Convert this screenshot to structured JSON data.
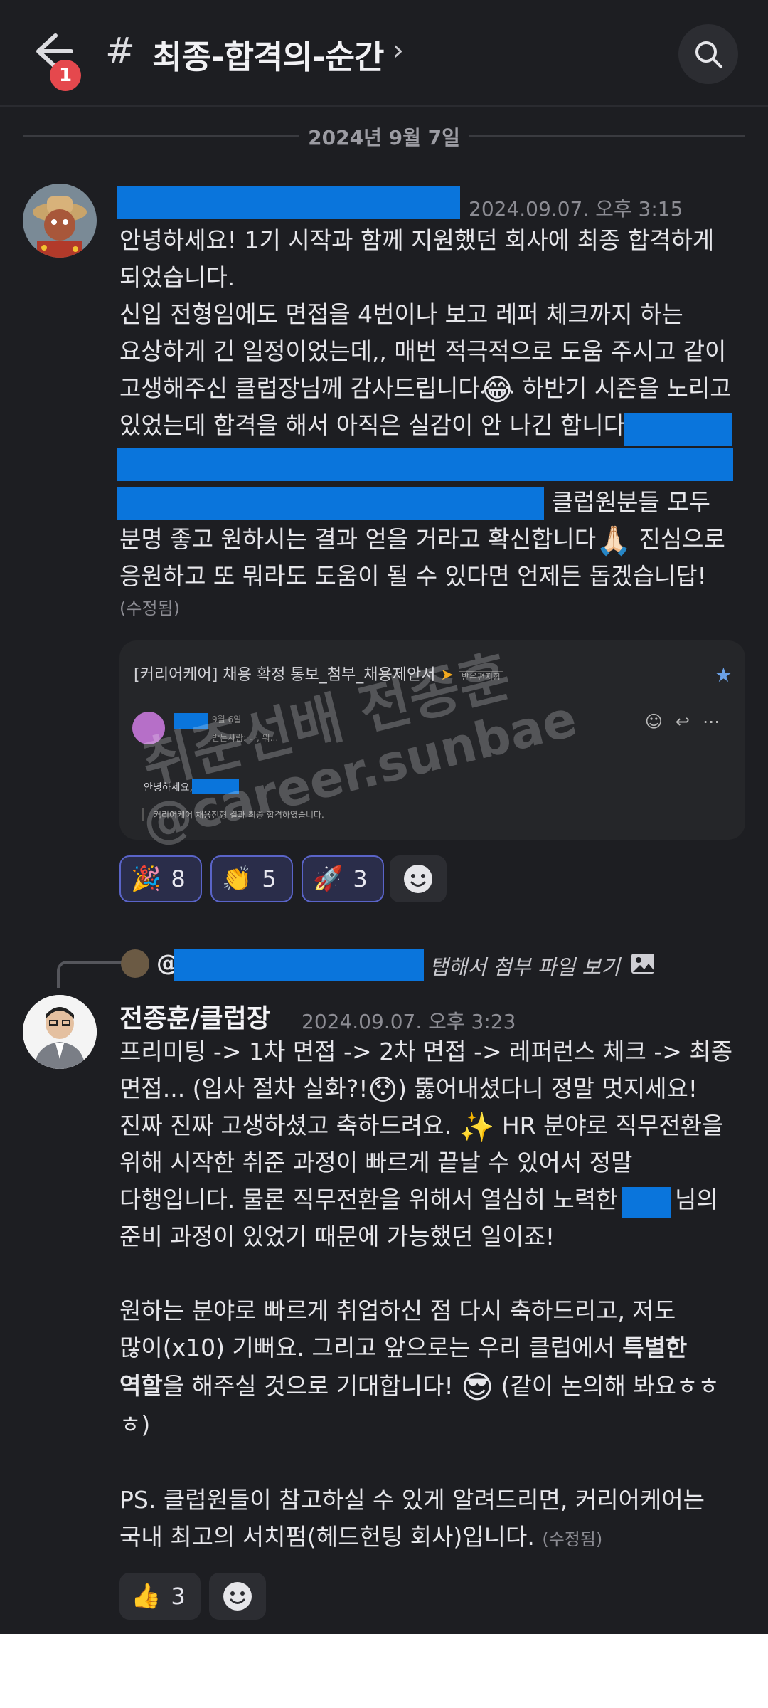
{
  "header": {
    "back_badge": "1",
    "hash": "#",
    "channel_title": "최종-합격의-순간",
    "chevron": "›"
  },
  "date_divider": "2024년 9월 7일",
  "message1": {
    "timestamp": "2024.09.07. 오후 3:15",
    "lines": [
      "안녕하세요! 1기 시작과 함께 지원했던 회사에 최종 합격하게",
      "되었습니다.",
      "신입 전형임에도 면접을 4번이나 보고 레퍼 체크까지 하는",
      "요상하게 긴 일정이었는데,, 매번 적극적으로 도움 주시고 같이",
      "고생해주신 클럽장님께 감사드립니다",
      "하반기 시즌을 노리고",
      "있었는데 합격을 해서 아직은 실감이 안 나긴 합니다",
      "클럽원분들 모두",
      "분명 좋고 원하시는 결과 얻을 거라고 확신합니다",
      "진심으로",
      "응원하고 또 뭐라도 도움이 될 수 있다면 언제든 돕겠습니답!"
    ],
    "edited": "(수정됨)"
  },
  "attachment": {
    "subject": "[커리어케어] 채용 확정 통보_첨부_채용제안서",
    "tag": "받은편지함",
    "meta_date": "9월 6일",
    "meta_to": "받는사람: 나, 워...",
    "greeting": "안녕하세요,",
    "quote": "커리어케어 채용전형 결과 최종 합격하였습니다."
  },
  "watermark": {
    "line1": "취준선배 전종훈",
    "line2": "@career.sunbae"
  },
  "reactions1": [
    {
      "emoji": "🎉",
      "count": "8"
    },
    {
      "emoji": "👏",
      "count": "5"
    },
    {
      "emoji": "🚀",
      "count": "3"
    }
  ],
  "reply_header": {
    "at": "@",
    "hint": "탭해서 첨부 파일 보기"
  },
  "message2": {
    "author": "전종훈/클럽장",
    "timestamp": "2024.09.07. 오후 3:23",
    "lines": [
      "프리미팅 -> 1차 면접 -> 2차 면접 -> 레퍼런스 체크 -> 최종",
      "면접... (입사 절차 실화?!",
      ") 뚫어내셨다니 정말 멋지세요!",
      "진짜 진짜 고생하셨고 축하드려요.",
      "HR 분야로 직무전환을",
      "위해 시작한 취준 과정이 빠르게 끝날 수 있어서 정말",
      "다행입니다. 물론 직무전환을 위해서 열심히 노력한",
      "님의",
      "준비 과정이 있었기 때문에 가능했던 일이죠!",
      "원하는 분야로 빠르게 취업하신 점 다시 축하드리고, 저도",
      "많이(x10) 기뻐요. 그리고 앞으로는 우리 클럽에서",
      "특별한",
      "역할",
      "을 해주실 것으로 기대합니다!",
      "(같이 논의해 봐요ㅎㅎ",
      "ㅎ)",
      "PS. 클럽원들이 참고하실 수 있게 알려드리면, 커리어케어는",
      "국내 최고의 서치펌(헤드헌팅 회사)입니다."
    ],
    "edited": "(수정됨)"
  },
  "reactions2": [
    {
      "emoji": "👍",
      "count": "3"
    }
  ],
  "emojis": {
    "tears": "😂",
    "smile": "😊",
    "pray": "🙏🏻",
    "surprised": "😯",
    "sparkles": "✨",
    "cool": "😎"
  }
}
